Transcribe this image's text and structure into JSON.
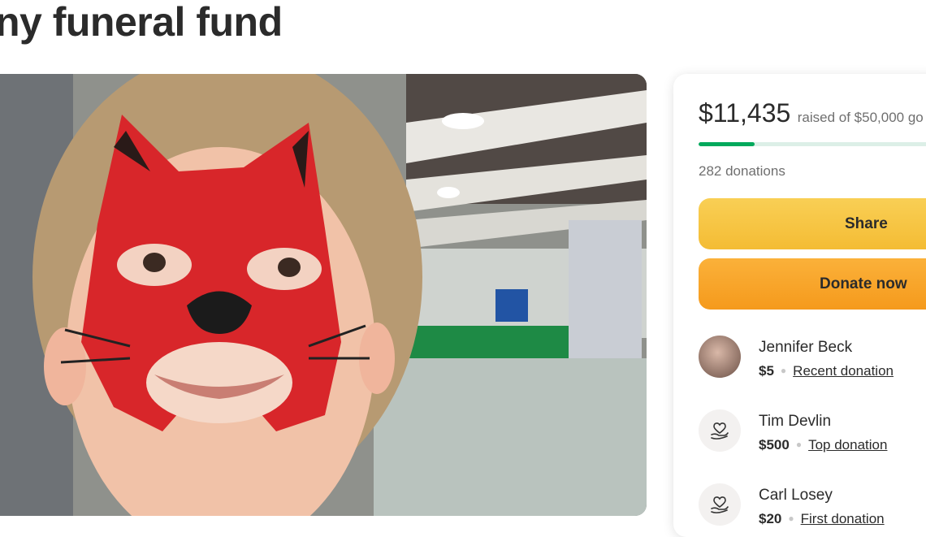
{
  "page": {
    "title": "ny funeral fund"
  },
  "campaign": {
    "raised_amount": "$11,435",
    "raised_text": "raised of $50,000 go",
    "progress_fraction": 0.2287,
    "donations_count": "282 donations",
    "share_label": "Share",
    "donate_label": "Donate now"
  },
  "donors": [
    {
      "name": "Jennifer Beck",
      "amount": "$5",
      "tag": "Recent donation",
      "avatar": "photo"
    },
    {
      "name": "Tim Devlin",
      "amount": "$500",
      "tag": "Top donation",
      "avatar": "heart-hand-icon"
    },
    {
      "name": "Carl Losey",
      "amount": "$20",
      "tag": "First donation",
      "avatar": "heart-hand-icon"
    }
  ],
  "colors": {
    "progress": "#02a95c",
    "share": "#f6c440",
    "donate": "#f7a427"
  }
}
